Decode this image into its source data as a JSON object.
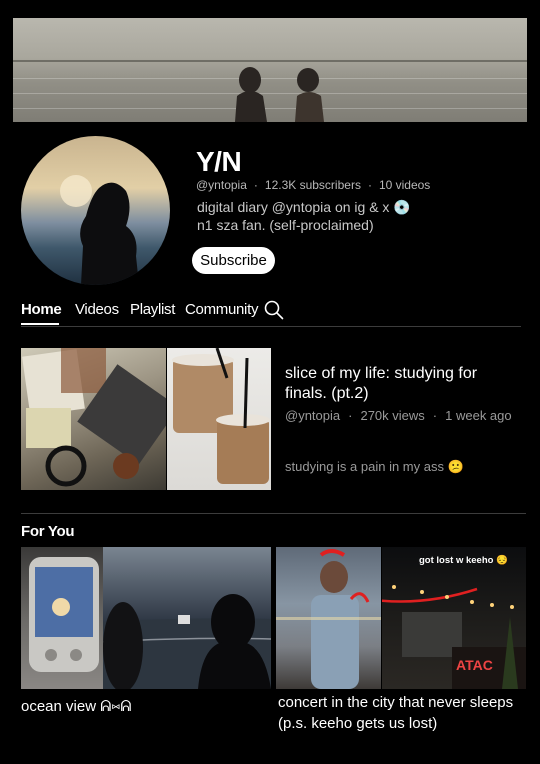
{
  "channel": {
    "name": "Y/N",
    "handle": "@yntopia",
    "subscribers": "12.3K subscribers",
    "video_count": "10 videos",
    "bio_line1": "digital diary @yntopia on ig & x 💿",
    "bio_line2": "n1 sza fan. (self-proclaimed)",
    "subscribe_label": "Subscribe"
  },
  "tabs": [
    {
      "label": "Home",
      "active": true
    },
    {
      "label": "Videos"
    },
    {
      "label": "Playlist"
    },
    {
      "label": "Community"
    }
  ],
  "featured": {
    "title": "slice of my life: studying for finals. (pt.2)",
    "channel": "@yntopia",
    "views": "270k views",
    "age": "1 week ago",
    "description": "studying is a pain in my ass 😕"
  },
  "for_you": {
    "heading": "For You",
    "videos": [
      {
        "title": "ocean view ᕱ⑅ᕱ",
        "caption": ""
      },
      {
        "title": "concert in the city that never sleeps (p.s. keeho gets us lost)",
        "caption": "got lost w keeho 😔"
      }
    ]
  },
  "colors": {
    "background": "#000000",
    "text_primary": "#ffffff",
    "text_secondary": "#9a9a9a",
    "divider": "#3c3c3c"
  }
}
